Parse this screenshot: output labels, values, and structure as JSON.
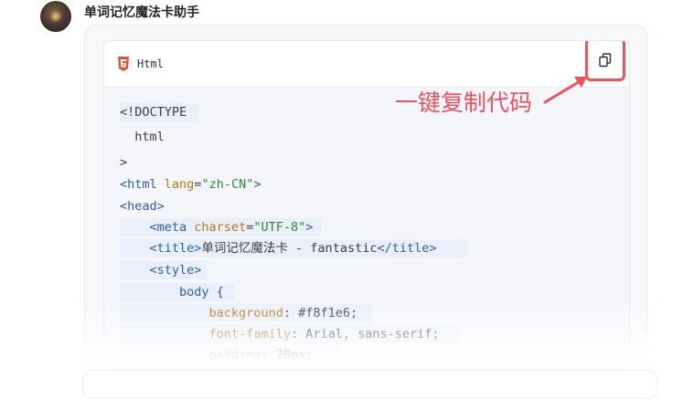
{
  "bot": {
    "name": "单词记忆魔法卡助手"
  },
  "code_block": {
    "language": "Html",
    "copy_icon": "copy-icon",
    "lines": [
      {
        "parts": [
          {
            "t": "<!DOCTYPE ",
            "c": "plain"
          }
        ]
      },
      {
        "parts": [
          {
            "t": "  html",
            "c": "plain"
          }
        ]
      },
      {
        "parts": [
          {
            "t": ">",
            "c": "plain"
          }
        ]
      },
      {
        "parts": [
          {
            "t": "<html ",
            "c": "tag"
          },
          {
            "t": "lang",
            "c": "attr"
          },
          {
            "t": "=",
            "c": "plain"
          },
          {
            "t": "\"zh-CN\"",
            "c": "str"
          },
          {
            "t": ">",
            "c": "tag"
          }
        ]
      },
      {
        "parts": [
          {
            "t": "<head>",
            "c": "tag"
          }
        ]
      },
      {
        "parts": [
          {
            "t": "    ",
            "c": "plain"
          },
          {
            "t": "<meta ",
            "c": "tag"
          },
          {
            "t": "charset",
            "c": "attr"
          },
          {
            "t": "=",
            "c": "plain"
          },
          {
            "t": "\"UTF-8\"",
            "c": "str"
          },
          {
            "t": ">",
            "c": "tag"
          }
        ]
      },
      {
        "parts": [
          {
            "t": "    ",
            "c": "plain"
          },
          {
            "t": "<title>",
            "c": "tag"
          },
          {
            "t": "单词记忆魔法卡 - fantastic",
            "c": "plain"
          },
          {
            "t": "</title>",
            "c": "tag"
          }
        ]
      },
      {
        "parts": [
          {
            "t": "    ",
            "c": "plain"
          },
          {
            "t": "<style>",
            "c": "tag"
          }
        ]
      },
      {
        "parts": [
          {
            "t": "        body {",
            "c": "tag"
          }
        ]
      },
      {
        "parts": [
          {
            "t": "            ",
            "c": "plain"
          },
          {
            "t": "background",
            "c": "prop"
          },
          {
            "t": ": #f8f1e6;",
            "c": "plain"
          }
        ]
      },
      {
        "parts": [
          {
            "t": "            ",
            "c": "plain"
          },
          {
            "t": "font-family",
            "c": "prop"
          },
          {
            "t": ": Arial, sans-serif;",
            "c": "plain"
          }
        ]
      },
      {
        "parts": [
          {
            "t": "            ",
            "c": "plain"
          },
          {
            "t": "padding",
            "c": "prop"
          },
          {
            "t": ": 20px;",
            "c": "plain"
          }
        ]
      }
    ]
  },
  "annotation": {
    "text": "一键复制代码"
  },
  "colors": {
    "accent": "#f0515a",
    "tag": "#2a5db0",
    "attr": "#b5791a",
    "string": "#2f8a3a"
  }
}
